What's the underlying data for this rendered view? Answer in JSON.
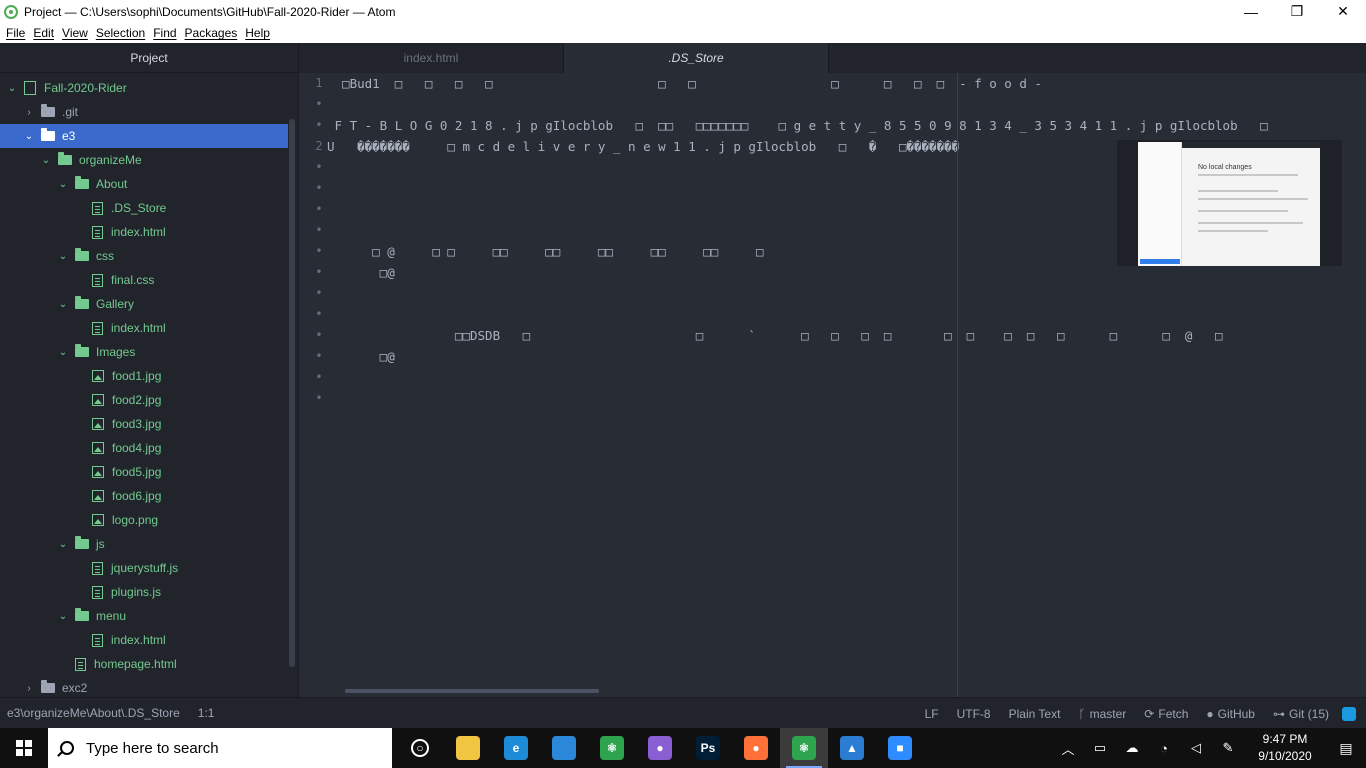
{
  "window": {
    "title": "Project — C:\\Users\\sophi\\Documents\\GitHub\\Fall-2020-Rider — Atom",
    "minimize": "—",
    "maximize": "❐",
    "close": "✕"
  },
  "menu": [
    "File",
    "Edit",
    "View",
    "Selection",
    "Find",
    "Packages",
    "Help"
  ],
  "tree_view": {
    "header": "Project",
    "items": [
      {
        "label": "Fall-2020-Rider",
        "kind": "repo",
        "depth": 0,
        "chevron": "⌄",
        "green": true
      },
      {
        "label": ".git",
        "kind": "folder",
        "depth": 1,
        "chevron": "›",
        "green": false
      },
      {
        "label": "e3",
        "kind": "folder",
        "depth": 1,
        "chevron": "⌄",
        "green": true,
        "selected": true
      },
      {
        "label": "organizeMe",
        "kind": "folder",
        "depth": 2,
        "chevron": "⌄",
        "green": true
      },
      {
        "label": "About",
        "kind": "folder",
        "depth": 3,
        "chevron": "⌄",
        "green": true
      },
      {
        "label": ".DS_Store",
        "kind": "file",
        "depth": 4,
        "green": true
      },
      {
        "label": "index.html",
        "kind": "file",
        "depth": 4,
        "green": true
      },
      {
        "label": "css",
        "kind": "folder",
        "depth": 3,
        "chevron": "⌄",
        "green": true
      },
      {
        "label": "final.css",
        "kind": "file",
        "depth": 4,
        "green": true
      },
      {
        "label": "Gallery",
        "kind": "folder",
        "depth": 3,
        "chevron": "⌄",
        "green": true
      },
      {
        "label": "index.html",
        "kind": "file",
        "depth": 4,
        "green": true
      },
      {
        "label": "Images",
        "kind": "folder",
        "depth": 3,
        "chevron": "⌄",
        "green": true
      },
      {
        "label": "food1.jpg",
        "kind": "image",
        "depth": 4,
        "green": true
      },
      {
        "label": "food2.jpg",
        "kind": "image",
        "depth": 4,
        "green": true
      },
      {
        "label": "food3.jpg",
        "kind": "image",
        "depth": 4,
        "green": true
      },
      {
        "label": "food4.jpg",
        "kind": "image",
        "depth": 4,
        "green": true
      },
      {
        "label": "food5.jpg",
        "kind": "image",
        "depth": 4,
        "green": true
      },
      {
        "label": "food6.jpg",
        "kind": "image",
        "depth": 4,
        "green": true
      },
      {
        "label": "logo.png",
        "kind": "image",
        "depth": 4,
        "green": true
      },
      {
        "label": "js",
        "kind": "folder",
        "depth": 3,
        "chevron": "⌄",
        "green": true
      },
      {
        "label": "jquerystuff.js",
        "kind": "file",
        "depth": 4,
        "green": true
      },
      {
        "label": "plugins.js",
        "kind": "file",
        "depth": 4,
        "green": true
      },
      {
        "label": "menu",
        "kind": "folder",
        "depth": 3,
        "chevron": "⌄",
        "green": true
      },
      {
        "label": "index.html",
        "kind": "file",
        "depth": 4,
        "green": true
      },
      {
        "label": "homepage.html",
        "kind": "file",
        "depth": 3,
        "green": true
      },
      {
        "label": "exc2",
        "kind": "folder",
        "depth": 1,
        "chevron": "›",
        "green": false
      }
    ]
  },
  "tabs": [
    {
      "label": "index.html",
      "active": false
    },
    {
      "label": ".DS_Store",
      "active": true
    }
  ],
  "editor": {
    "gutter": [
      "1",
      "•",
      "•",
      "2",
      "•",
      "•",
      "•",
      "•",
      "•",
      "•",
      "•",
      "•",
      "•",
      "•",
      "•",
      "•"
    ],
    "lines": [
      "  □Bud1  □   □   □   □                      □   □                  □      □   □  □  - f o o d -",
      "",
      " F T - B L O G 0 2 1 8 . j p gIlocblob   □  □□   □□□□□□□    □ g e t t y _ 8 5 5 0 9 8 1 3 4 _ 3 5 3 4 1 1 . j p gIlocblob   □",
      "U   �������     □ m c d e l i v e r y _ n e w 1 1 . j p gIlocblob   □   �   □�������",
      "",
      "",
      "",
      "",
      "      □ @     □ □     □□     □□     □□     □□     □□     □",
      "       □@",
      "",
      "",
      "                 □□DSDB   □                      □      `      □   □   □  □       □  □    □  □   □      □      □  @   □",
      "       □@",
      "",
      ""
    ],
    "preview_heading": "No local changes"
  },
  "status": {
    "path": "e3\\organizeMe\\About\\.DS_Store",
    "cursor": "1:1",
    "line_ending": "LF",
    "encoding": "UTF-8",
    "grammar": "Plain Text",
    "branch": "master",
    "fetch": "Fetch",
    "github": "GitHub",
    "git": "Git (15)"
  },
  "taskbar": {
    "search_placeholder": "Type here to search",
    "apps": [
      {
        "name": "task-view",
        "glyph": "○",
        "color": "#101010"
      },
      {
        "name": "file-explorer",
        "glyph": "",
        "color": "#f0c541"
      },
      {
        "name": "edge",
        "glyph": "e",
        "color": "#1e8bd8"
      },
      {
        "name": "store",
        "glyph": "",
        "color": "#2b88d8"
      },
      {
        "name": "atom",
        "glyph": "⚛",
        "color": "#2ea44f"
      },
      {
        "name": "github-desktop",
        "glyph": "●",
        "color": "#8a5fd3"
      },
      {
        "name": "photoshop",
        "glyph": "Ps",
        "color": "#001e36"
      },
      {
        "name": "firefox",
        "glyph": "●",
        "color": "#ff7139"
      },
      {
        "name": "atom-active",
        "glyph": "⚛",
        "color": "#2ea44f",
        "active": true
      },
      {
        "name": "photos",
        "glyph": "▲",
        "color": "#2b7cd3"
      },
      {
        "name": "zoom",
        "glyph": "■",
        "color": "#2d8cff"
      }
    ],
    "time": "9:47 PM",
    "date": "9/10/2020"
  },
  "colors": {
    "selection": "#3a6bcc",
    "git_added": "#73c990",
    "editor_bg": "#282c34",
    "panel_bg": "#21252b"
  }
}
